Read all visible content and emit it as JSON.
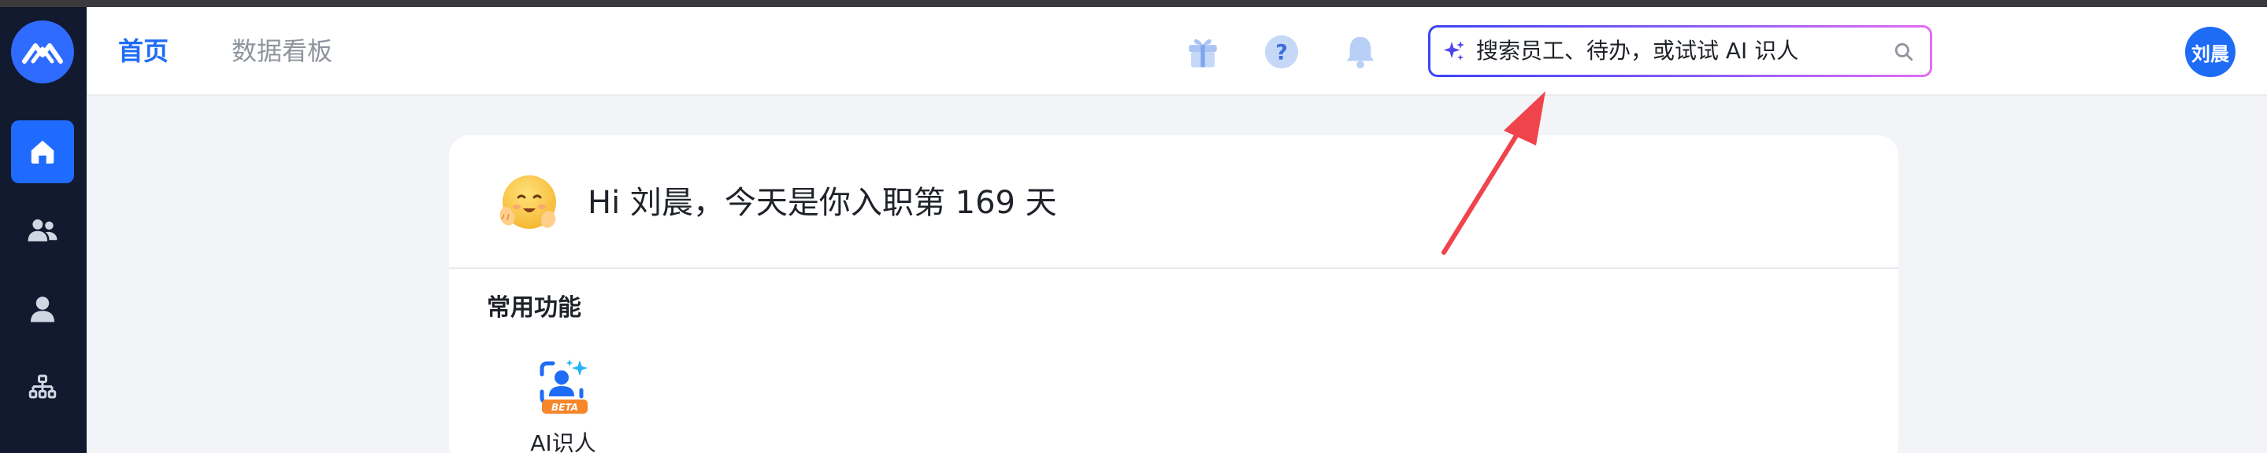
{
  "header": {
    "tabs": [
      {
        "label": "首页",
        "active": true
      },
      {
        "label": "数据看板",
        "active": false
      }
    ],
    "search": {
      "placeholder": "搜索员工、待办，或试试 AI 识人",
      "icon": "sparkle-icon"
    },
    "icons": [
      "gift-icon",
      "help-icon",
      "bell-icon"
    ],
    "avatar_text": "刘晨"
  },
  "sidebar": {
    "logo": "app-logo",
    "items": [
      {
        "icon": "home-icon",
        "active": true
      },
      {
        "icon": "team-icon",
        "active": false
      },
      {
        "icon": "user-icon",
        "active": false
      },
      {
        "icon": "org-chart-icon",
        "active": false
      }
    ]
  },
  "main": {
    "greeting": "Hi 刘晨，今天是你入职第 169 天",
    "section_title": "常用功能",
    "functions": [
      {
        "label": "AI识人",
        "badge": "BETA"
      }
    ]
  },
  "colors": {
    "accent": "#1e6cf6",
    "sidebar_bg": "#111a2e",
    "annotation_arrow": "#f0444c"
  }
}
